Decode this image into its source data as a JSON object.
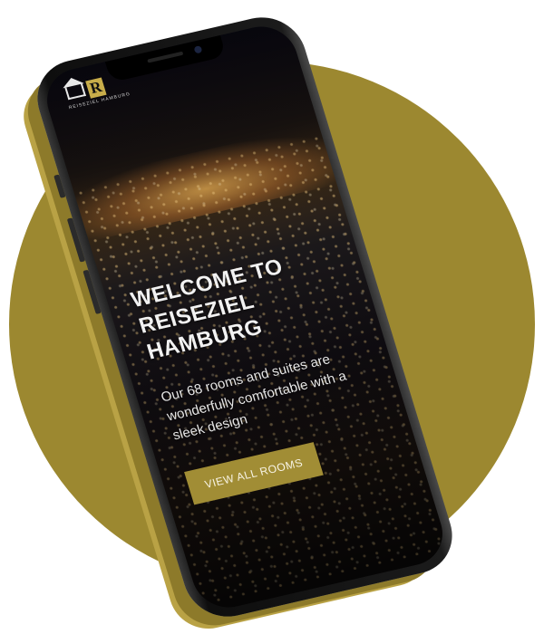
{
  "brand": {
    "logo_letter": "R",
    "logo_subtitle": "REISEZIEL HAMBURG"
  },
  "hero": {
    "title_line1": "WELCOME TO",
    "title_line2": "REISEZIEL HAMBURG",
    "description": "Our 68 rooms and suites are wonderfully comfortable with a sleek design",
    "cta_label": "VIEW ALL ROOMS"
  },
  "colors": {
    "accent": "#9c8830",
    "button": "#a18d35",
    "screen_background": "#141016"
  },
  "icons": [
    "house-logo-icon"
  ]
}
